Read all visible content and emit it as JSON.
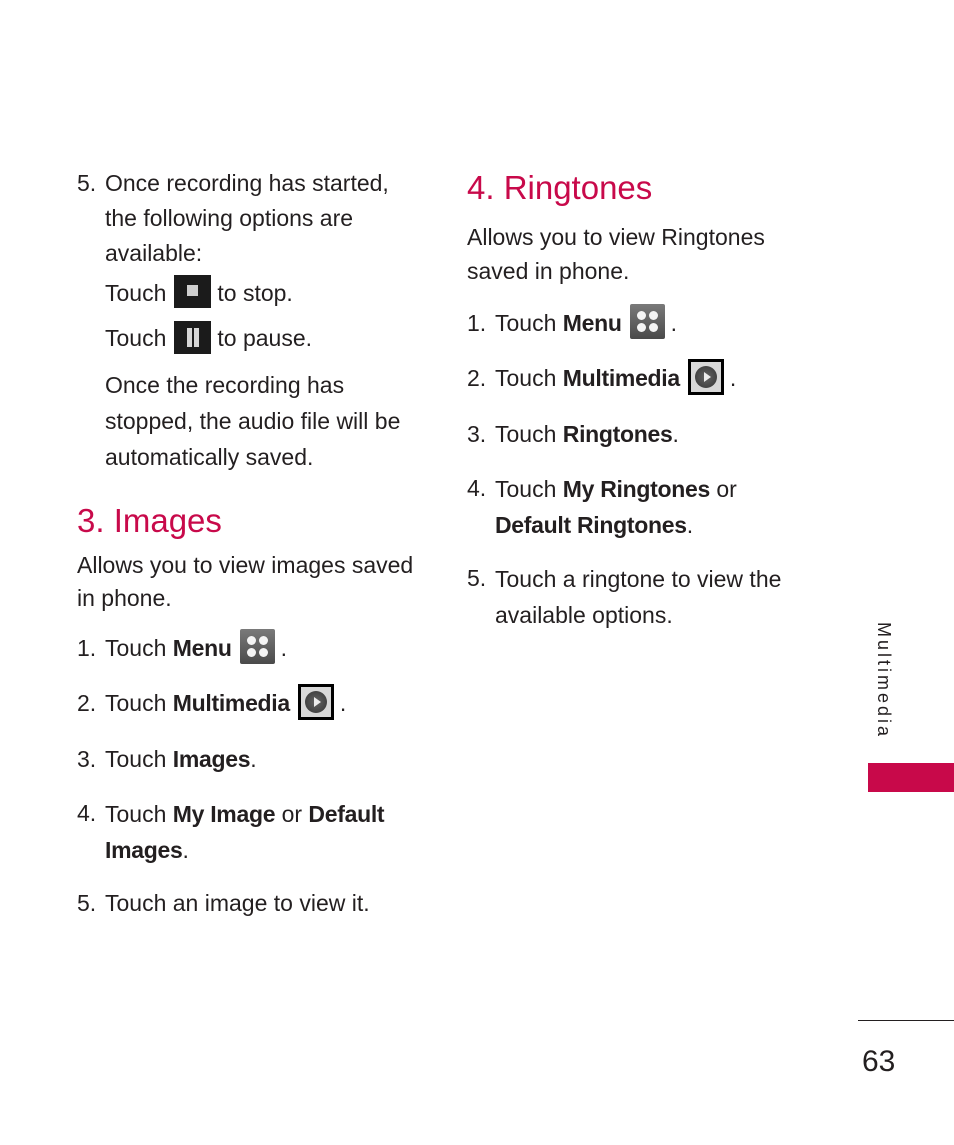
{
  "left_column": {
    "recording_step": {
      "num": "5.",
      "text": "Once recording has started, the following options are available:",
      "stop_pre": "Touch",
      "stop_post": "to stop.",
      "pause_pre": "Touch",
      "pause_post": "to pause.",
      "note": "Once the recording has stopped, the audio file will be automatically saved."
    },
    "images": {
      "heading": "3. Images",
      "intro": "Allows you to view images saved in phone.",
      "steps": [
        {
          "num": "1.",
          "pre": "Touch ",
          "bold": "Menu",
          "post": "."
        },
        {
          "num": "2.",
          "pre": "Touch ",
          "bold": "Multimedia",
          "post": "."
        },
        {
          "num": "3.",
          "pre": "Touch ",
          "bold": "Images",
          "post": "."
        },
        {
          "num": "4.",
          "pre": "Touch ",
          "bold": "My Image",
          "mid": " or ",
          "bold2": "Default Images",
          "post": "."
        },
        {
          "num": "5.",
          "text": "Touch an image to view it."
        }
      ]
    }
  },
  "right_column": {
    "ringtones": {
      "heading": "4. Ringtones",
      "intro": "Allows you to view Ringtones saved in phone.",
      "steps": [
        {
          "num": "1.",
          "pre": "Touch ",
          "bold": "Menu",
          "post": "."
        },
        {
          "num": "2.",
          "pre": "Touch ",
          "bold": "Multimedia",
          "post": "."
        },
        {
          "num": "3.",
          "pre": "Touch ",
          "bold": "Ringtones",
          "post": "."
        },
        {
          "num": "4.",
          "pre": "Touch ",
          "bold": "My Ringtones",
          "mid": " or ",
          "bold2": "Default Ringtones",
          "post": "."
        },
        {
          "num": "5.",
          "text": "Touch a ringtone to view the available options."
        }
      ]
    }
  },
  "sidebar": {
    "section_label": "Multimedia",
    "accent_color": "#c8094a"
  },
  "footer": {
    "page_number": "63"
  }
}
